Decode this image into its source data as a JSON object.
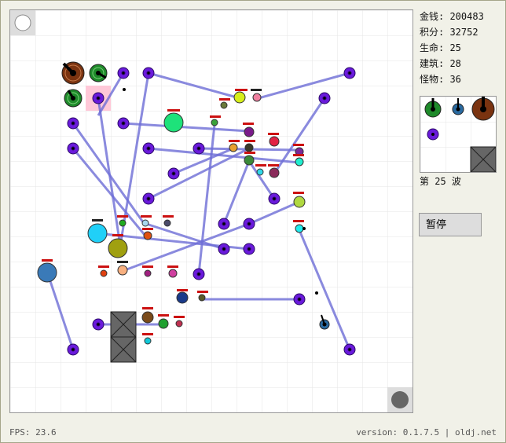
{
  "stats": {
    "money": "金钱: 200483",
    "score": "积分: 32752",
    "life": "生命: 25",
    "buildings": "建筑: 28",
    "monsters": "怪物: 36"
  },
  "wave_label": "第 25 波",
  "pause_label": "暂停",
  "fps": "FPS: 23.6",
  "version": "version: 0.1.7.5 | oldj.net",
  "colors": {
    "laser": "#6d6dd6",
    "tower_purple": "#6a1adb",
    "health_bar": "#cc1111",
    "block": "#666666"
  }
}
